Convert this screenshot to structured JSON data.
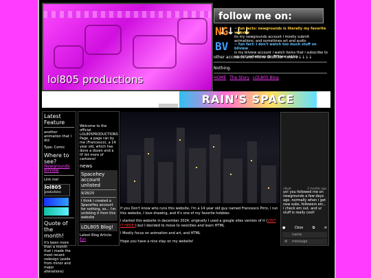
{
  "header": {
    "banner_title": "lol805 productions",
    "follow_title": "follow me on:",
    "follow_arrows": "↓↓↓↓",
    "newgrounds_badge": "NG",
    "newgrounds_fact_title": "~ fun facts: newgrounds is literally my favorite website",
    "newgrounds_fact_body": "its my newgrounds account i mostly submit animations, and sometimes art and audio",
    "bluesky_badge": "BV",
    "bluesky_fact_title": "~ fun fact: i don't watch too much stuff on bilview",
    "bluesky_fact_body": "is my bilview account i watch items that i subscribe to og, not sometimes fan bilview videos",
    "other_accounts": "other accounts and more stuff(for now)↓↓↓↓↓",
    "nothing_text": "Nothing.",
    "nav": [
      "HOME",
      "The Story",
      "LOL805 Blog"
    ]
  },
  "ad": {
    "text": "RAIN'S SPACE"
  },
  "left": {
    "latest_feature_title": "Latest Feature",
    "latest_feature_text": "another animation that I did",
    "type_text": "Type: Comic",
    "where_title": "Where to see?",
    "links": [
      "Newgrounds",
      "BilView"
    ],
    "link_me": "Link me!",
    "button_text": "lol805",
    "button_sub": "productions",
    "quote_title": "Quote of the month!",
    "quote_text": "It's been more than a month that i made the most recent redesign (aside from minor and major alterations)"
  },
  "mid": {
    "welcome": "Welcome to the official LOL805PRODUCTIONS Page, a page ran by me (Francesco), a 14 year old, which has done a dozen and a lil' bit more of cartoons!",
    "news_title": "news",
    "news_item_title": "Spacehey account unlisted",
    "news_date": "9/28/25",
    "news_body": "I think i created a SpaceHey account for nothing, so... i'm unlisting it from this website",
    "blog_title": "LOL805 Blog!",
    "latest_blog": "Latest Blog Article:",
    "latest_blog_link": "Eyn"
  },
  "main": {
    "p1": "If you Don't know who runs this website, I'm a 14 year old guy named Francesco Pirro, I run this website, I love drawing, and it's one of my favorite hobbies",
    "p2a": "I started this website in december 2024, originally I used a google sites version of it (",
    "p2link": "VISIT IT HERE!",
    "p2b": ") but I decided to move to neocities and learn HTML",
    "p3": "I Mostly focus on animation and art, and HTML",
    "p4": "Hope you have a nice stay on my website!"
  },
  "chat": {
    "user": "ribeat",
    "time": "2 months ago",
    "message": "yo! you followed me on newgrounds a few days ago. normally when i get new subs, followers etc., i check em out. and ur stuff is really cool!",
    "send_label": "Cbox",
    "name_placeholder": "name",
    "message_placeholder": "message"
  }
}
